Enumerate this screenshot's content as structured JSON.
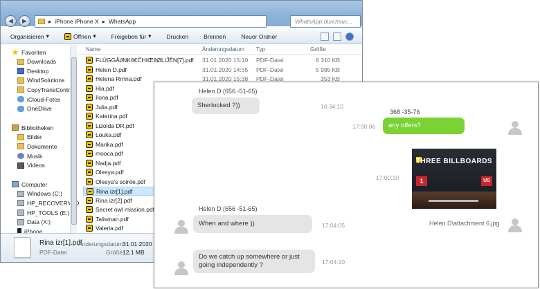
{
  "explorer": {
    "breadcrumb": [
      "iPhone iPhone X",
      "WhatsApp"
    ],
    "search_placeholder": "WhatsApp durchsuc...",
    "toolbar": [
      "Organisieren",
      "Öffnen",
      "Freigeben für",
      "Drucken",
      "Brennen",
      "Neuer Ordner"
    ],
    "nav": [
      {
        "label": "Favoriten",
        "icon": "star-icon",
        "indent": 0
      },
      {
        "label": "Downloads",
        "icon": "folder-icon",
        "indent": 1
      },
      {
        "label": "Desktop",
        "icon": "desktop-icon",
        "indent": 1
      },
      {
        "label": "WindSolutions",
        "icon": "folder-icon",
        "indent": 1
      },
      {
        "label": "CopyTransContro",
        "icon": "folder-icon",
        "indent": 1
      },
      {
        "label": "iCloud-Fotos",
        "icon": "cloud-icon",
        "indent": 1
      },
      {
        "label": "OneDrive",
        "icon": "cloud-icon",
        "indent": 1
      },
      {
        "label": "Bibliotheken",
        "icon": "library-icon",
        "indent": 0
      },
      {
        "label": "Bilder",
        "icon": "folder-icon",
        "indent": 1
      },
      {
        "label": "Dokumente",
        "icon": "folder-icon",
        "indent": 1
      },
      {
        "label": "Musik",
        "icon": "music-icon",
        "indent": 1
      },
      {
        "label": "Videos",
        "icon": "video-icon",
        "indent": 1
      },
      {
        "label": "Computer",
        "icon": "computer-icon",
        "indent": 0
      },
      {
        "label": "Windows (C:)",
        "icon": "drive-icon",
        "indent": 1
      },
      {
        "label": "HP_RECOVERY (D",
        "icon": "drive-icon",
        "indent": 1
      },
      {
        "label": "HP_TOOLS (E:)",
        "icon": "drive-icon",
        "indent": 1
      },
      {
        "label": "Data (X:)",
        "icon": "drive-icon",
        "indent": 1
      },
      {
        "label": "iPhone",
        "icon": "phone-icon",
        "indent": 1
      }
    ],
    "columns": [
      "Name",
      "Änderungsdatum",
      "Typ",
      "Größe"
    ],
    "files": [
      {
        "name": "FLÜGGÅ∂NK6€ĈHIŒ8ØLIĴÊN[7].pdf",
        "date": "31.01.2020 15:10",
        "type": "PDF-Datei",
        "size": "6 310 KB"
      },
      {
        "name": "Helen D.pdf",
        "date": "31.01.2020 14:55",
        "type": "PDF-Datei",
        "size": "5 995 KB"
      },
      {
        "name": "Helena Rrrina.pdf",
        "date": "31.01.2020 15:38",
        "type": "PDF-Datei",
        "size": "353 KB"
      },
      {
        "name": "Hia.pdf",
        "date": "",
        "type": "",
        "size": ""
      },
      {
        "name": "Ilona.pdf",
        "date": "",
        "type": "",
        "size": ""
      },
      {
        "name": "Julia.pdf",
        "date": "",
        "type": "",
        "size": ""
      },
      {
        "name": "Katerina.pdf",
        "date": "",
        "type": "",
        "size": ""
      },
      {
        "name": "Lizolda DR.pdf",
        "date": "",
        "type": "",
        "size": ""
      },
      {
        "name": "Louka.pdf",
        "date": "",
        "type": "",
        "size": ""
      },
      {
        "name": "Marika.pdf",
        "date": "",
        "type": "",
        "size": ""
      },
      {
        "name": "mooca.pdf",
        "date": "",
        "type": "",
        "size": ""
      },
      {
        "name": "Nadja.pdf",
        "date": "",
        "type": "",
        "size": ""
      },
      {
        "name": "Olesya.pdf",
        "date": "",
        "type": "",
        "size": ""
      },
      {
        "name": "Olesya's soirée.pdf",
        "date": "",
        "type": "",
        "size": ""
      },
      {
        "name": "Rina izr[1].pdf",
        "date": "",
        "type": "",
        "size": "",
        "selected": true
      },
      {
        "name": "Rina izr[2].pdf",
        "date": "",
        "type": "",
        "size": ""
      },
      {
        "name": "Secret owl mission.pdf",
        "date": "",
        "type": "",
        "size": ""
      },
      {
        "name": "Talisman.pdf",
        "date": "",
        "type": "",
        "size": ""
      },
      {
        "name": "Valeria.pdf",
        "date": "",
        "type": "",
        "size": ""
      }
    ],
    "status": {
      "filename": "Rina izr[1].pdf",
      "date_label": "Änderungsdatum:",
      "date_value": "31.01.2020 14:",
      "type": "PDF-Datei",
      "size_label": "Größe:",
      "size_value": "12,1 MB"
    }
  },
  "chat": {
    "messages": [
      {
        "sender": "Helen D  (656 -51-65)",
        "text": "Sherlocked ?))",
        "time": "16:34:10",
        "side": "left"
      },
      {
        "sender": "368 -35-76",
        "text": "any offers?",
        "time": "17:00:06",
        "side": "right"
      },
      {
        "attachment_title": "THREE BILLBOARDS",
        "time": "17:00:10",
        "side": "right"
      },
      {
        "sender": "Helen D  (656 -51-65)",
        "text": "When and where ))",
        "time": "17:04:05",
        "side": "left",
        "attachment_name": "Helen D\\attachment 6.jpg"
      },
      {
        "text": "Do we catch up somewhere or just going independently ?",
        "time": "17:04:10",
        "side": "left"
      }
    ]
  }
}
